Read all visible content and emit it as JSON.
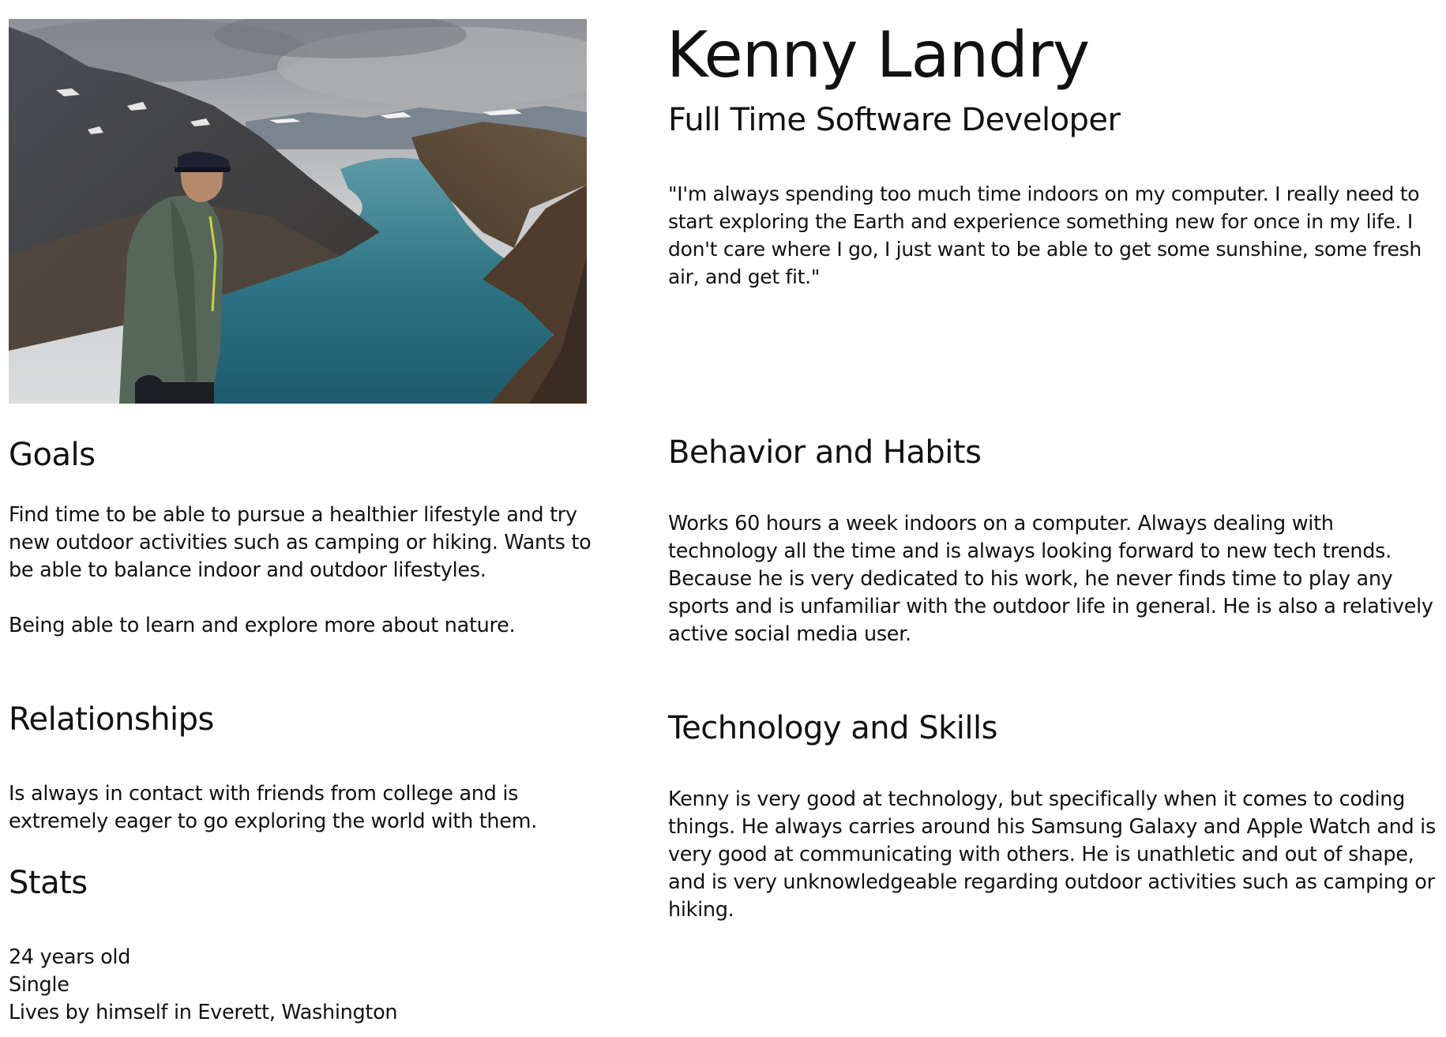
{
  "profile": {
    "name": "Kenny Landry",
    "role": "Full Time Software Developer",
    "quote": "\"I'm always spending too much time indoors on my computer. I really need to start exploring the Earth and experience something new for once in my life. I don't care where I go, I just want to be able to get some sunshine, some fresh air, and get fit.\""
  },
  "goals": {
    "heading": "Goals",
    "paragraphs": [
      "Find time to be able to pursue a healthier lifestyle and try new outdoor activities such as camping or hiking. Wants to be able to balance indoor and outdoor lifestyles.",
      "Being able to learn and explore more about nature."
    ]
  },
  "relationships": {
    "heading": "Relationships",
    "text": "Is always in contact with friends from college and is extremely eager to go exploring the world with them."
  },
  "stats": {
    "heading": "Stats",
    "items": [
      "24 years old",
      "Single",
      "Lives by himself in Everett, Washington"
    ]
  },
  "behavior": {
    "heading": "Behavior and Habits",
    "text": "Works 60 hours a week indoors on a computer. Always dealing with technology all the time and is always looking forward to new tech trends. Because he is very dedicated to his work, he never finds time to play any sports and is unfamiliar with the outdoor life in general. He is also a relatively active social media user."
  },
  "technology": {
    "heading": "Technology and Skills",
    "text": "Kenny is very good at technology, but specifically when it comes to coding things. He always carries around his Samsung Galaxy and Apple Watch and is very good at communicating with others. He is unathletic and out of shape, and is very unknowledgeable regarding outdoor activities such as camping or hiking."
  }
}
